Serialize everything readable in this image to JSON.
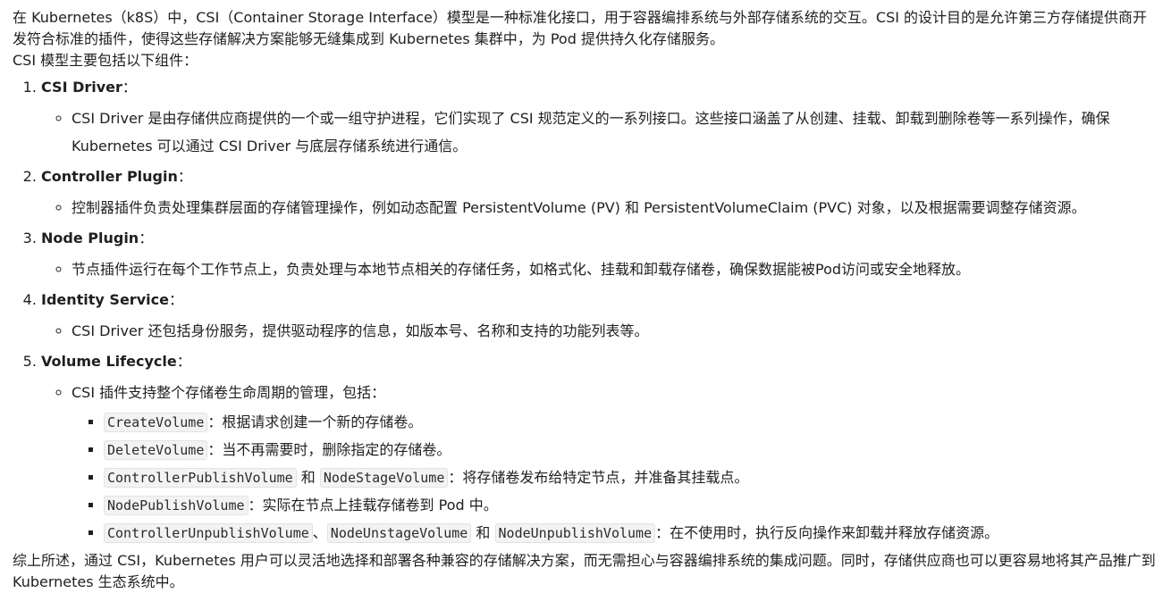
{
  "intro": {
    "paragraph1": "在 Kubernetes（k8S）中，CSI（Container Storage Interface）模型是一种标准化接口，用于容器编排系统与外部存储系统的交互。CSI 的设计目的是允许第三方存储提供商开发符合标准的插件，使得这些存储解决方案能够无缝集成到 Kubernetes 集群中，为 Pod 提供持久化存储服务。",
    "paragraph2": "CSI 模型主要包括以下组件："
  },
  "components": [
    {
      "title": "CSI Driver",
      "colon": "：",
      "desc": "CSI Driver 是由存储供应商提供的一个或一组守护进程，它们实现了 CSI 规范定义的一系列接口。这些接口涵盖了从创建、挂载、卸载到删除卷等一系列操作，确保 Kubernetes 可以通过 CSI Driver 与底层存储系统进行通信。"
    },
    {
      "title": "Controller Plugin",
      "colon": "：",
      "desc": "控制器插件负责处理集群层面的存储管理操作，例如动态配置 PersistentVolume (PV) 和 PersistentVolumeClaim (PVC) 对象，以及根据需要调整存储资源。"
    },
    {
      "title": "Node Plugin",
      "colon": "：",
      "desc": "节点插件运行在每个工作节点上，负责处理与本地节点相关的存储任务，如格式化、挂载和卸载存储卷，确保数据能被Pod访问或安全地释放。"
    },
    {
      "title": "Identity Service",
      "colon": "：",
      "desc": "CSI Driver 还包括身份服务，提供驱动程序的信息，如版本号、名称和支持的功能列表等。"
    },
    {
      "title": "Volume Lifecycle",
      "colon": "：",
      "desc": "CSI 插件支持整个存储卷生命周期的管理，包括："
    }
  ],
  "lifecycle_ops": [
    {
      "code1": "CreateVolume",
      "desc": "：根据请求创建一个新的存储卷。"
    },
    {
      "code1": "DeleteVolume",
      "desc": "：当不再需要时，删除指定的存储卷。"
    },
    {
      "code1": "ControllerPublishVolume",
      "sep1": " 和 ",
      "code2": "NodeStageVolume",
      "desc": "：将存储卷发布给特定节点，并准备其挂载点。"
    },
    {
      "code1": "NodePublishVolume",
      "desc": "：实际在节点上挂载存储卷到 Pod 中。"
    },
    {
      "code1": "ControllerUnpublishVolume",
      "sep1": "、",
      "code2": "NodeUnstageVolume",
      "sep2": " 和 ",
      "code3": "NodeUnpublishVolume",
      "desc": "：在不使用时，执行反向操作来卸载并释放存储资源。"
    }
  ],
  "summary": "综上所述，通过 CSI，Kubernetes 用户可以灵活地选择和部署各种兼容的存储解决方案，而无需担心与容器编排系统的集成问题。同时，存储供应商也可以更容易地将其产品推广到 Kubernetes 生态系统中。"
}
